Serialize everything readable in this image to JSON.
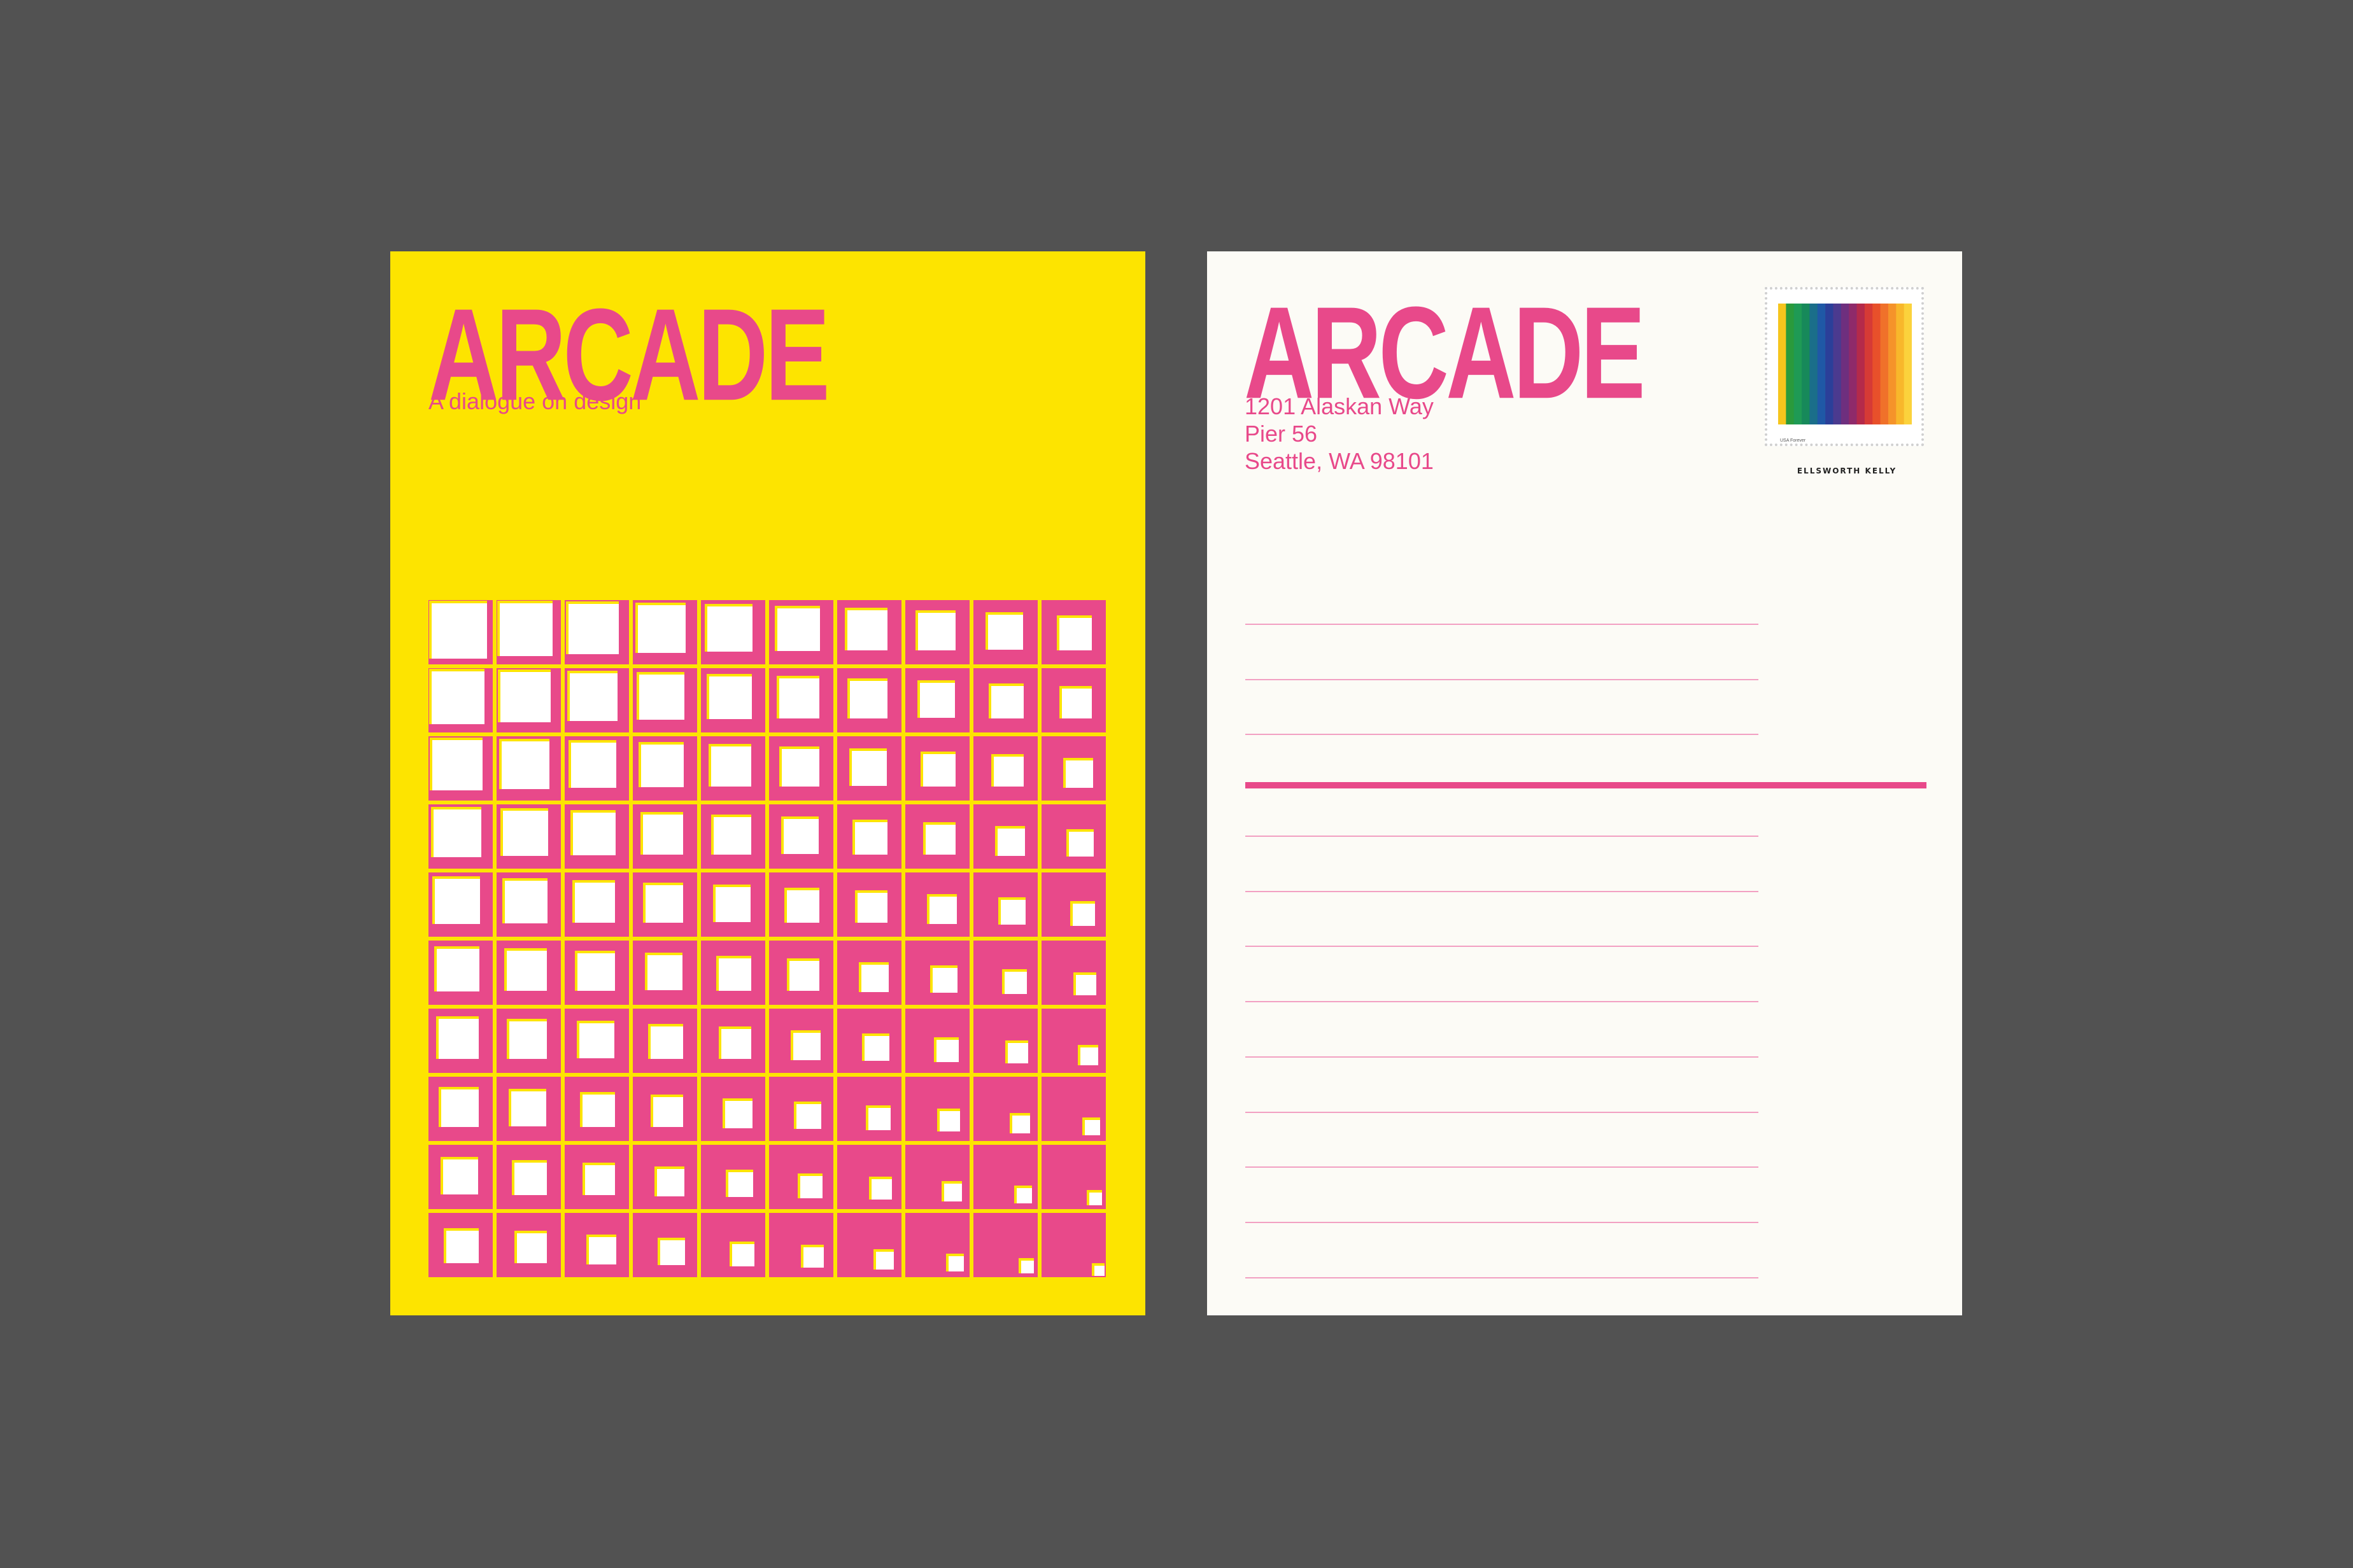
{
  "front": {
    "brand": "ARCADE",
    "tagline": "A dialogue on design"
  },
  "back": {
    "brand": "ARCADE",
    "address": [
      "1201 Alaskan Way",
      "Pier 56",
      "Seattle, WA 98101"
    ],
    "stamp": {
      "caption": "ELLSWORTH KELLY",
      "small_text": "USA Forever"
    },
    "address_line_count": 3,
    "message_line_count": 9
  },
  "colors": {
    "background": "#525252",
    "front_card": "#fde400",
    "back_card": "#fcfbf6",
    "accent_pink": "#e8498a",
    "rule_pink": "#f2a0c2",
    "stamp_stripes": [
      "#f6c51d",
      "#2a9a3c",
      "#1f9a55",
      "#17895a",
      "#1a6e8a",
      "#1f58a6",
      "#2b3f99",
      "#4b3a8f",
      "#6e2f7e",
      "#8f2a6a",
      "#b52a4a",
      "#d63a36",
      "#e8502a",
      "#f0712a",
      "#f5932a",
      "#f8b72b",
      "#fbd23c"
    ]
  }
}
